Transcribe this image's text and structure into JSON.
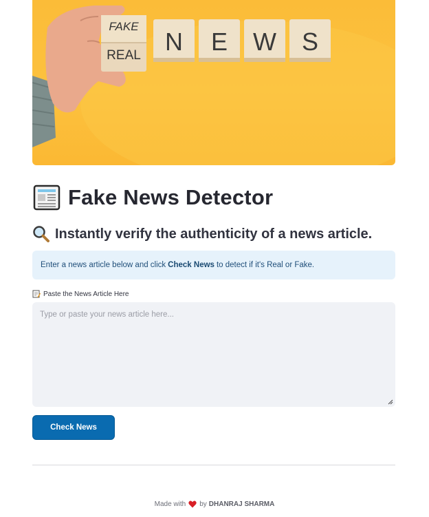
{
  "banner": {
    "cube_fake": "FAKE",
    "cube_real": "REAL",
    "cube_letters": [
      "N",
      "E",
      "W",
      "S"
    ]
  },
  "header": {
    "title": "Fake News Detector",
    "subtitle": "Instantly verify the authenticity of a news article."
  },
  "info": {
    "prefix": "Enter a news article below and click",
    "bold": "Check News",
    "suffix": "to detect if it's Real or Fake."
  },
  "input": {
    "label": "Paste the News Article Here",
    "placeholder": "Type or paste your news article here...",
    "value": ""
  },
  "button": {
    "label": "Check News"
  },
  "footer": {
    "made_with": "Made with",
    "by": "by",
    "author": "DHANRAJ SHARMA"
  },
  "colors": {
    "accent": "#0a6bb0",
    "info_bg": "#e6f2fb",
    "input_bg": "#f0f2f6",
    "banner_bg": "#fbbc38"
  },
  "icons": [
    "newspaper-icon",
    "magnifier-icon",
    "memo-icon",
    "heart-icon"
  ]
}
